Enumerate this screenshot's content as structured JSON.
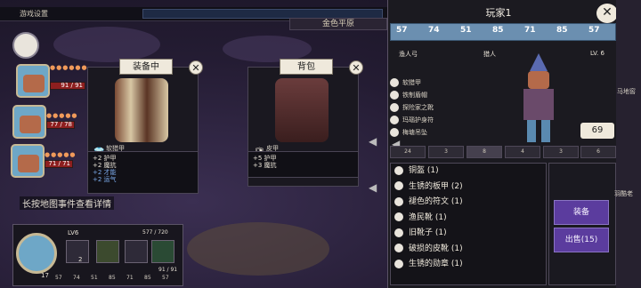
{
  "topbar": {
    "title": "游戏设置",
    "region": "金色平原"
  },
  "party": [
    {
      "hp": "91 / 91"
    },
    {
      "hp": "77 / 78"
    },
    {
      "hp": "71 / 71"
    }
  ],
  "equipped_card": {
    "header": "装备中",
    "item_name": "软猎甲",
    "rarity": "普通",
    "stats": [
      "+2 护甲",
      "+2 魔抗",
      "+2 才能",
      "+2 运气"
    ]
  },
  "backpack_card": {
    "header": "背包",
    "item_name": "皮甲",
    "rarity": "普通",
    "stats": [
      "+5 护甲",
      "+3 魔抗"
    ]
  },
  "hint": "长按地图事件查看详情",
  "bottom": {
    "level": "LV6",
    "xp": "577 / 720",
    "count": "2",
    "hp": "91 / 91",
    "token": "17",
    "stats": [
      "57",
      "74",
      "51",
      "85",
      "71",
      "85",
      "57"
    ]
  },
  "player": {
    "title": "玩家1",
    "stats": [
      "57",
      "74",
      "51",
      "85",
      "71",
      "85",
      "57"
    ],
    "class_left": "渔人弓",
    "class_right": "猎人",
    "level": "LV. 6",
    "equipment": [
      "软猎甲",
      "铁制盾帽",
      "探险家之靴",
      "玛瑙护身符",
      "梅塘吊坠"
    ],
    "weight": "69"
  },
  "tabs": [
    "24",
    "3",
    "8",
    "4",
    "3",
    "6"
  ],
  "inventory": [
    "铜盔 (1)",
    "生锈的板甲 (2)",
    "褪色的符文 (1)",
    "渔民靴 (1)",
    "旧靴子 (1)",
    "破损的皮靴 (1)",
    "生锈的勋章 (1)"
  ],
  "actions": {
    "equip": "装备",
    "sell": "出售(15)"
  },
  "side_labels": {
    "upper": "马地窖",
    "lower": "羽酷老"
  },
  "colors": {
    "accent": "#5b3c9e",
    "stat_bar": "#6b8fb0",
    "hp": "#8e1f1f"
  }
}
